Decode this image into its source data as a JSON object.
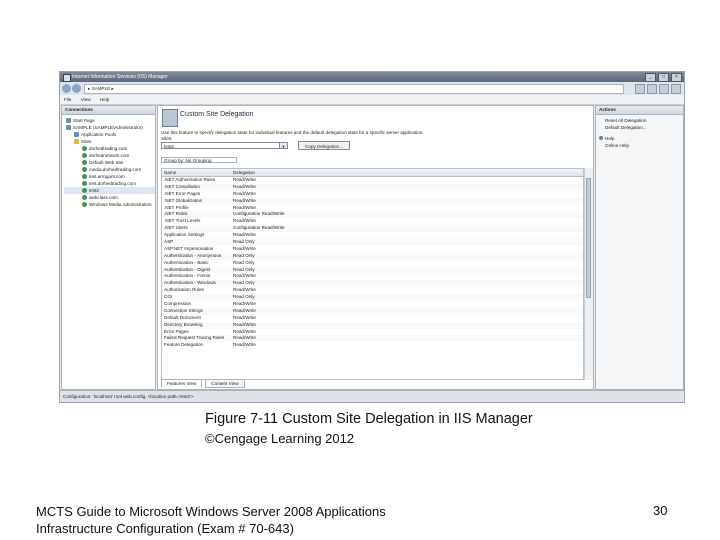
{
  "window": {
    "title": "Internet Information Services (IIS) Manager",
    "address_path": "▸ SAMPLE ▸",
    "buttons": [
      "_",
      "□",
      "×"
    ]
  },
  "menu": [
    "File",
    "View",
    "Help"
  ],
  "connections": {
    "title": "Connections",
    "tree": [
      {
        "label": "Start Page",
        "icon": "start-page-icon"
      },
      {
        "label": "SAMPLE (SAMPLE\\Administrator)",
        "icon": "server-icon"
      },
      {
        "label": "Application Pools",
        "icon": "app-pool-icon"
      },
      {
        "label": "Sites",
        "icon": "folder-icon"
      },
      {
        "label": "dorhedtrading.com",
        "icon": "globe-icon"
      },
      {
        "label": "dorhednetwork.com",
        "icon": "globe-icon"
      },
      {
        "label": "Default Web Site",
        "icon": "globe-icon"
      },
      {
        "label": "media.dorhedtrading.com",
        "icon": "globe-icon"
      },
      {
        "label": "test.arrogant.com",
        "icon": "globe-icon"
      },
      {
        "label": "test.dorhedtrading.com",
        "icon": "globe-icon"
      },
      {
        "label": "test2",
        "icon": "globe-icon"
      },
      {
        "label": "webclass.com",
        "icon": "globe-icon"
      },
      {
        "label": "Windows Media Administration",
        "icon": "globe-icon"
      }
    ]
  },
  "main": {
    "title": "Custom Site Delegation",
    "description": "Use this feature to specify delegation state for individual features and the default delegation state for a specific server application.",
    "users_label": "Sites:",
    "selected_site": "test2",
    "copy_button": "Copy Delegation...",
    "group_by": "Group by: No Grouping",
    "columns": [
      "Name",
      "Delegation"
    ],
    "rows": [
      [
        ".NET Authorization Rules",
        "Read/Write"
      ],
      [
        ".NET Compilation",
        "Read/Write"
      ],
      [
        ".NET Error Pages",
        "Read/Write"
      ],
      [
        ".NET Globalization",
        "Read/Write"
      ],
      [
        ".NET Profile",
        "Read/Write"
      ],
      [
        ".NET Roles",
        "Configuration Read/Write"
      ],
      [
        ".NET Trust Levels",
        "Read/Write"
      ],
      [
        ".NET Users",
        "Configuration Read/Write"
      ],
      [
        "Application Settings",
        "Read/Write"
      ],
      [
        "ASP",
        "Read Only"
      ],
      [
        "ASP.NET Impersonation",
        "Read/Write"
      ],
      [
        "Authentication - Anonymous",
        "Read Only"
      ],
      [
        "Authentication - Basic",
        "Read Only"
      ],
      [
        "Authentication - Digest",
        "Read Only"
      ],
      [
        "Authentication - Forms",
        "Read/Write"
      ],
      [
        "Authentication - Windows",
        "Read Only"
      ],
      [
        "Authorization Rules",
        "Read/Write"
      ],
      [
        "CGI",
        "Read Only"
      ],
      [
        "Compression",
        "Read/Write"
      ],
      [
        "Connection Strings",
        "Read/Write"
      ],
      [
        "Default Document",
        "Read/Write"
      ],
      [
        "Directory Browsing",
        "Read/Write"
      ],
      [
        "Error Pages",
        "Read/Write"
      ],
      [
        "Failed Request Tracing Rules",
        "Read/Write"
      ],
      [
        "Feature Delegation",
        "Read/Write"
      ]
    ],
    "view_tabs": [
      "Features View",
      "Content View"
    ]
  },
  "actions": {
    "title": "Actions",
    "items": [
      "Reset All Delegation",
      "Default Delegation...",
      "Help",
      "Online Help"
    ]
  },
  "statusbar": "Configuration: 'localhost' root web.config, <location path='test2'>",
  "caption": "Figure 7-11 Custom Site Delegation in IIS Manager",
  "copyright": "©Cengage Learning 2012",
  "footer": {
    "line1": "MCTS Guide to Microsoft Windows Server 2008 Applications",
    "line2": "Infrastructure Configuration (Exam # 70-643)",
    "page": "30"
  }
}
